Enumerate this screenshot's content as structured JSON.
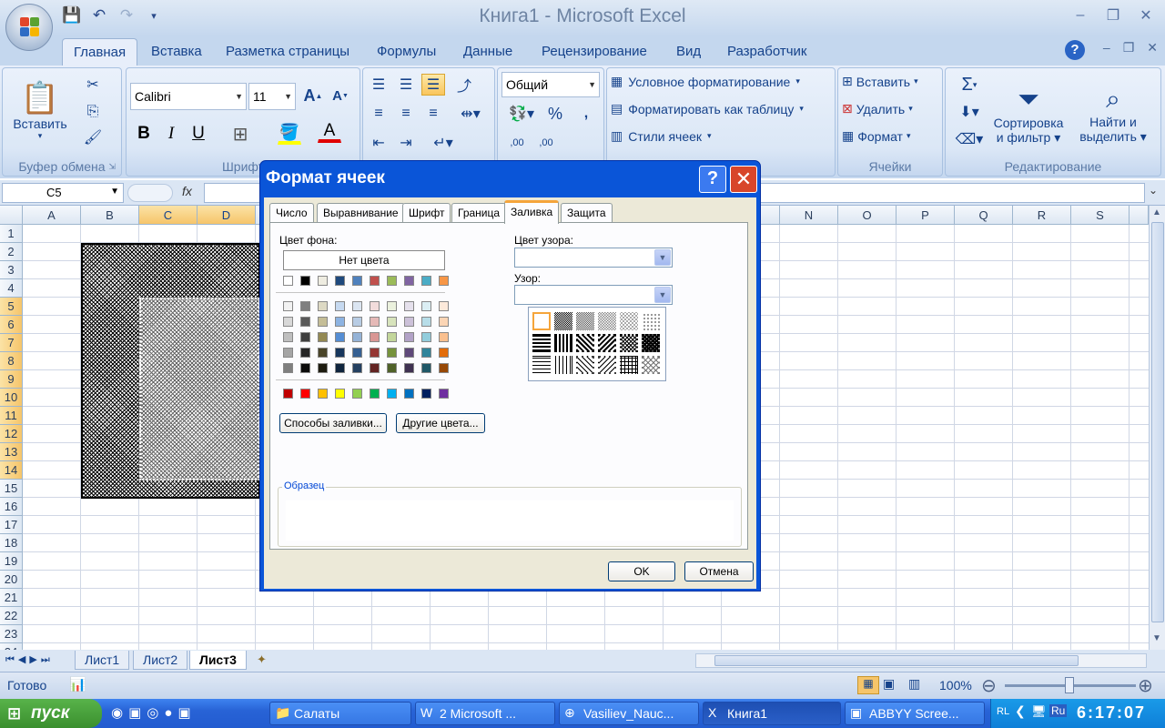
{
  "app_title": "Книга1 - Microsoft Excel",
  "ribbon_tabs": [
    "Главная",
    "Вставка",
    "Разметка страницы",
    "Формулы",
    "Данные",
    "Рецензирование",
    "Вид",
    "Разработчик"
  ],
  "active_tab": "Главная",
  "clipboard": {
    "paste": "Вставить",
    "group": "Буфер обмена"
  },
  "font": {
    "name": "Calibri",
    "size": "11",
    "bold": "B",
    "italic": "I",
    "underline": "U",
    "group": "Шрифт"
  },
  "number": {
    "format": "Общий",
    "percent": "%",
    "comma": ",",
    "inc_dec": ",00",
    "dec_dec": ",00"
  },
  "styles": {
    "conditional": "Условное форматирование",
    "as_table": "Форматировать как таблицу",
    "cell_styles": "Стили ячеек"
  },
  "cells": {
    "insert": "Вставить",
    "delete": "Удалить",
    "format": "Формат",
    "group": "Ячейки"
  },
  "editing": {
    "sort_1": "Сортировка",
    "sort_2": "и фильтр",
    "find_1": "Найти и",
    "find_2": "выделить",
    "group": "Редактирование",
    "sigma": "Σ"
  },
  "formula_bar": {
    "name_box": "C5",
    "fx": "fx",
    "formula": ""
  },
  "columns": [
    "A",
    "B",
    "C",
    "D",
    "E",
    "F",
    "G",
    "H",
    "I",
    "J",
    "K",
    "L",
    "M",
    "N",
    "O",
    "P",
    "Q",
    "R",
    "S"
  ],
  "rows": [
    "1",
    "2",
    "3",
    "4",
    "5",
    "6",
    "7",
    "8",
    "9",
    "10",
    "11",
    "12",
    "13",
    "14",
    "15",
    "16",
    "17",
    "18",
    "19",
    "20",
    "21",
    "22",
    "23",
    "24"
  ],
  "sheets": [
    "Лист1",
    "Лист2",
    "Лист3"
  ],
  "active_sheet": "Лист3",
  "status": {
    "ready": "Готово",
    "zoom": "100%"
  },
  "dialog": {
    "title": "Формат ячеек",
    "tabs": [
      "Число",
      "Выравнивание",
      "Шрифт",
      "Граница",
      "Заливка",
      "Защита"
    ],
    "active_tab": "Заливка",
    "bg_color_label": "Цвет фона:",
    "no_color": "Нет цвета",
    "pattern_color_label": "Цвет узора:",
    "pattern_label": "Узор:",
    "fill_effects": "Способы заливки...",
    "more_colors": "Другие цвета...",
    "sample_label": "Образец",
    "ok": "OK",
    "cancel": "Отмена",
    "theme_top": [
      "#ffffff",
      "#000000",
      "#eeece1",
      "#1f497d",
      "#4f81bd",
      "#c0504d",
      "#9bbb59",
      "#8064a2",
      "#4bacc6",
      "#f79646"
    ],
    "theme_rows": [
      [
        "#f2f2f2",
        "#7f7f7f",
        "#ddd9c3",
        "#c6d9f0",
        "#dbe5f1",
        "#f2dcdb",
        "#ebf1dd",
        "#e5e0ec",
        "#dbeef3",
        "#fdeada"
      ],
      [
        "#d8d8d8",
        "#595959",
        "#c4bd97",
        "#8db3e2",
        "#b8cce4",
        "#e5b9b7",
        "#d7e3bc",
        "#ccc1d9",
        "#b7dde8",
        "#fbd5b5"
      ],
      [
        "#bfbfbf",
        "#3f3f3f",
        "#938953",
        "#548dd4",
        "#95b3d7",
        "#d99694",
        "#c3d69b",
        "#b2a2c7",
        "#92cddc",
        "#fac08f"
      ],
      [
        "#a5a5a5",
        "#262626",
        "#494429",
        "#17365d",
        "#366092",
        "#953734",
        "#76923c",
        "#5f497a",
        "#31859b",
        "#e36c09"
      ],
      [
        "#7f7f7f",
        "#0c0c0c",
        "#1d1b10",
        "#0f243e",
        "#244061",
        "#632423",
        "#4f6128",
        "#3f3151",
        "#205867",
        "#974806"
      ]
    ],
    "standard": [
      "#c00000",
      "#ff0000",
      "#ffc000",
      "#ffff00",
      "#92d050",
      "#00b050",
      "#00b0f0",
      "#0070c0",
      "#002060",
      "#7030a0"
    ]
  },
  "taskbar": {
    "start": "пуск",
    "tasks": [
      "Салаты",
      "2 Microsoft ...",
      "Vasiliev_Nauc...",
      "Книга1",
      "ABBYY Scree..."
    ],
    "active_task": "Книга1",
    "lang": "RL",
    "lang2": "Ru",
    "clock": "6:17:07"
  }
}
